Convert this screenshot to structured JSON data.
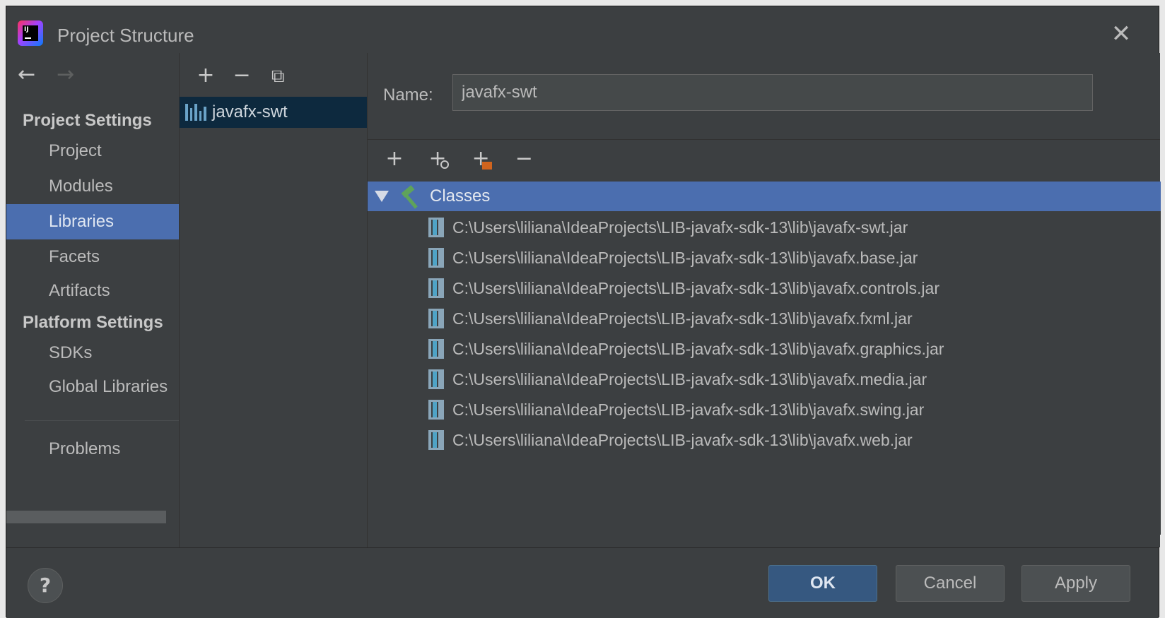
{
  "window": {
    "title": "Project Structure",
    "logo_text": "IJ"
  },
  "nav": {
    "back_icon": "←",
    "forward_icon": "→",
    "sections": [
      {
        "label": "Project Settings"
      },
      {
        "label": "Platform Settings"
      }
    ],
    "items": [
      {
        "label": "Project"
      },
      {
        "label": "Modules"
      },
      {
        "label": "Libraries"
      },
      {
        "label": "Facets"
      },
      {
        "label": "Artifacts"
      },
      {
        "label": "SDKs"
      },
      {
        "label": "Global Libraries"
      },
      {
        "label": "Problems"
      }
    ],
    "selected": "Libraries"
  },
  "middle": {
    "toolbar": {
      "add": "+",
      "remove": "−",
      "copy": "⧉"
    },
    "libraries": [
      {
        "label": "javafx-swt"
      }
    ]
  },
  "detail": {
    "name_label": "Name:",
    "name_value": "javafx-swt",
    "toolbar": {
      "add": "+",
      "add_url": "+",
      "add_folder": "+",
      "remove": "−"
    },
    "tree": {
      "root_label": "Classes",
      "jars": [
        "C:\\Users\\liliana\\IdeaProjects\\LIB-javafx-sdk-13\\lib\\javafx-swt.jar",
        "C:\\Users\\liliana\\IdeaProjects\\LIB-javafx-sdk-13\\lib\\javafx.base.jar",
        "C:\\Users\\liliana\\IdeaProjects\\LIB-javafx-sdk-13\\lib\\javafx.controls.jar",
        "C:\\Users\\liliana\\IdeaProjects\\LIB-javafx-sdk-13\\lib\\javafx.fxml.jar",
        "C:\\Users\\liliana\\IdeaProjects\\LIB-javafx-sdk-13\\lib\\javafx.graphics.jar",
        "C:\\Users\\liliana\\IdeaProjects\\LIB-javafx-sdk-13\\lib\\javafx.media.jar",
        "C:\\Users\\liliana\\IdeaProjects\\LIB-javafx-sdk-13\\lib\\javafx.swing.jar",
        "C:\\Users\\liliana\\IdeaProjects\\LIB-javafx-sdk-13\\lib\\javafx.web.jar"
      ]
    }
  },
  "buttons": {
    "help": "?",
    "ok": "OK",
    "cancel": "Cancel",
    "apply": "Apply"
  },
  "colors": {
    "background": "#3c3f41",
    "selection": "#4b6eaf",
    "primary_button": "#365880",
    "library_row": "#0d293e"
  }
}
